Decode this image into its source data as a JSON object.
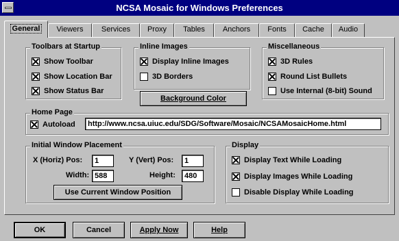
{
  "window": {
    "title": "NCSA Mosaic for Windows Preferences"
  },
  "tabs": [
    {
      "label": "General",
      "active": true
    },
    {
      "label": "Viewers"
    },
    {
      "label": "Services"
    },
    {
      "label": "Proxy"
    },
    {
      "label": "Tables"
    },
    {
      "label": "Anchors"
    },
    {
      "label": "Fonts"
    },
    {
      "label": "Cache"
    },
    {
      "label": "Audio"
    }
  ],
  "toolbars": {
    "legend": "Toolbars at Startup",
    "items": [
      {
        "label": "Show Toolbar",
        "checked": true
      },
      {
        "label": "Show Location Bar",
        "checked": true
      },
      {
        "label": "Show Status Bar",
        "checked": true
      }
    ]
  },
  "inline_images": {
    "legend": "Inline Images",
    "items": [
      {
        "label": "Display Inline Images",
        "checked": true
      },
      {
        "label": "3D Borders",
        "checked": false
      }
    ],
    "background_button": "Background Color"
  },
  "misc": {
    "legend": "Miscellaneous",
    "items": [
      {
        "label": "3D Rules",
        "checked": true
      },
      {
        "label": "Round List Bullets",
        "checked": true
      },
      {
        "label": "Use Internal (8-bit) Sound",
        "checked": false
      }
    ]
  },
  "home": {
    "legend": "Home Page",
    "autoload_label": "Autoload",
    "autoload_checked": true,
    "url": "http://www.ncsa.uiuc.edu/SDG/Software/Mosaic/NCSAMosaicHome.html"
  },
  "placement": {
    "legend": "Initial Window Placement",
    "x_label": "X (Horiz) Pos:",
    "x_value": "1",
    "y_label": "Y (Vert) Pos:",
    "y_value": "1",
    "width_label": "Width:",
    "width_value": "588",
    "height_label": "Height:",
    "height_value": "480",
    "use_current_button": "Use Current Window Position"
  },
  "display": {
    "legend": "Display",
    "items": [
      {
        "label": "Display Text While Loading",
        "checked": true
      },
      {
        "label": "Display Images While Loading",
        "checked": true
      },
      {
        "label": "Disable Display While Loading",
        "checked": false
      }
    ]
  },
  "buttons": {
    "ok": "OK",
    "cancel": "Cancel",
    "apply": "Apply Now",
    "help": "Help"
  },
  "colors": {
    "title_bar": "#000080",
    "face": "#c0c0c0"
  }
}
